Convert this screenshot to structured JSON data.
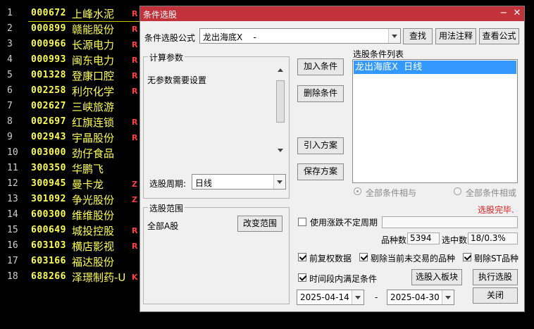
{
  "stock_list": {
    "rows": [
      {
        "idx": "1",
        "code": "000672",
        "name": "上峰水泥",
        "flag": "R"
      },
      {
        "idx": "2",
        "code": "000899",
        "name": "赣能股份",
        "flag": "R"
      },
      {
        "idx": "3",
        "code": "000966",
        "name": "长源电力",
        "flag": "R"
      },
      {
        "idx": "4",
        "code": "000993",
        "name": "闽东电力",
        "flag": "R"
      },
      {
        "idx": "5",
        "code": "001328",
        "name": "登康口腔",
        "flag": "R"
      },
      {
        "idx": "6",
        "code": "002258",
        "name": "利尔化学",
        "flag": "R"
      },
      {
        "idx": "7",
        "code": "002627",
        "name": "三峡旅游",
        "flag": ""
      },
      {
        "idx": "8",
        "code": "002697",
        "name": "红旗连锁",
        "flag": "R"
      },
      {
        "idx": "9",
        "code": "002943",
        "name": "宇晶股份",
        "flag": "R"
      },
      {
        "idx": "10",
        "code": "003000",
        "name": "劲仔食品",
        "flag": ""
      },
      {
        "idx": "11",
        "code": "300350",
        "name": "华鹏飞",
        "flag": ""
      },
      {
        "idx": "12",
        "code": "300945",
        "name": "曼卡龙",
        "flag": "Z"
      },
      {
        "idx": "13",
        "code": "301092",
        "name": "争光股份",
        "flag": "Z"
      },
      {
        "idx": "14",
        "code": "600300",
        "name": "维维股份",
        "flag": ""
      },
      {
        "idx": "15",
        "code": "600649",
        "name": "城投控股",
        "flag": "R"
      },
      {
        "idx": "16",
        "code": "603103",
        "name": "横店影视",
        "flag": "R"
      },
      {
        "idx": "17",
        "code": "603166",
        "name": "福达股份",
        "flag": ""
      },
      {
        "idx": "18",
        "code": "688266",
        "name": "泽璟制药-U",
        "flag": "K"
      }
    ]
  },
  "dialog": {
    "title": "条件选股",
    "formula_label": "条件选股公式",
    "formula_value": "龙出海底X    -",
    "btn_find": "查找",
    "btn_usage": "用法注释",
    "btn_view": "查看公式",
    "params_group": "计算参数",
    "params_text": "无参数需要设置",
    "period_label": "选股周期:",
    "period_value": "日线",
    "btn_add": "加入条件",
    "btn_delete": "删除条件",
    "btn_import": "引入方案",
    "btn_save": "保存方案",
    "cond_list_label": "选股条件列表",
    "cond_items": [
      "龙出海底X  日线"
    ],
    "radio_and": "全部条件相与",
    "radio_or": "全部条件相或",
    "status": "选股完毕.",
    "range_group": "选股范围",
    "range_value": "全部A股",
    "btn_change_range": "改变范围",
    "chk_uncertain_period": "使用涨跌不定周期",
    "count_label": "品种数",
    "count_value": "5394",
    "selected_label": "选中数",
    "selected_value": "18/0.3%",
    "chk_fq": "前复权数据",
    "chk_exclude_untraded": "剔除当前未交易的品种",
    "chk_exclude_st": "剔除ST品种",
    "chk_period_meet": "时间段内满足条件",
    "btn_to_block": "选股入板块",
    "btn_execute": "执行选股",
    "date_from": "2025-04-14",
    "date_sep": "-",
    "date_to": "2025-04-30",
    "btn_close": "关闭"
  },
  "colors": {
    "title_bar": "#c2323a",
    "code_text": "#ffff54",
    "flag_r": "#ff4040",
    "flag_z": "#ff4040",
    "flag_k": "#ff4040",
    "status_text": "#e02020",
    "list_selection": "#3399ff"
  }
}
